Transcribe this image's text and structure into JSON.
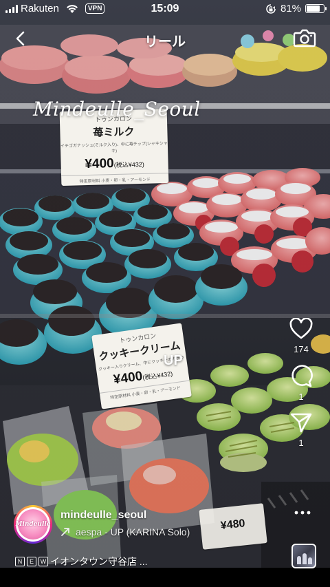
{
  "status_bar": {
    "carrier": "Rakuten",
    "vpn": "VPN",
    "time": "15:09",
    "battery": "81%",
    "battery_level": 0.81,
    "icons": [
      "signal-icon",
      "wifi-icon",
      "orientation-lock-icon",
      "battery-icon"
    ]
  },
  "nav": {
    "title": "リール",
    "back_icon": "chevron-left-icon",
    "camera_icon": "camera-icon"
  },
  "video": {
    "watermark": "Mindeulle_Seoul",
    "sticker_text": "UP",
    "price_tags": [
      {
        "category": "トゥンカロン",
        "name": "苺ミルク",
        "detail": "イチゴガナッシュ(ミルク入り)、中に苺チップ(シャキシャキ)",
        "price": "¥400",
        "tax": "(税込¥432)",
        "footer": "特定原材料 小麦・卵・乳・アーモンド"
      },
      {
        "category": "トゥンカロン",
        "name": "クッキークリーム",
        "detail": "クッキー入りクリーム、中にクッキーのカケラ",
        "price": "¥400",
        "tax": "(税込¥432)",
        "footer": "特定原材料 小麦・卵・乳・アーモンド"
      },
      {
        "category": "",
        "name": "",
        "detail": "",
        "price": "¥480",
        "tax": "",
        "footer": ""
      }
    ]
  },
  "actions": {
    "like": {
      "icon": "heart-icon",
      "count": "174"
    },
    "comment": {
      "icon": "comment-icon",
      "count": "1"
    },
    "share": {
      "icon": "send-icon",
      "count": "1"
    },
    "more_icon": "more-horizontal-icon"
  },
  "post": {
    "username": "mindeulle_seoul",
    "avatar_text": "Mindeulle",
    "music_icon": "trending-arrow-icon",
    "music": "aespa - UP (KARINA Solo)",
    "caption_badges": [
      "N",
      "E",
      "W"
    ],
    "caption": "イオンタウン守谷店 ..."
  },
  "colors": {
    "heart": "#ffffff",
    "text": "#ffffff",
    "background": "#000000"
  }
}
